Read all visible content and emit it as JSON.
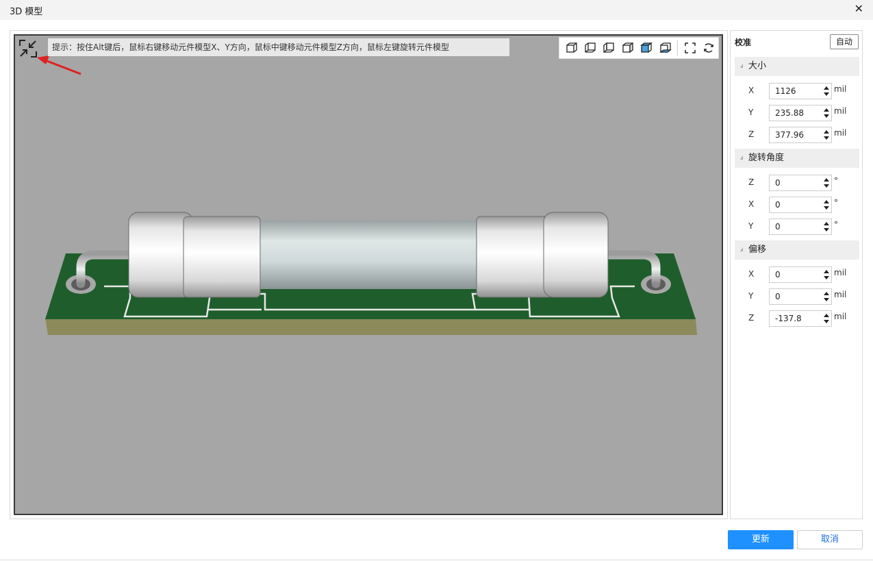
{
  "window": {
    "title": "3D 模型",
    "close_glyph": "✕"
  },
  "viewport": {
    "hint": "提示：按住Alt键后，鼠标右键移动元件模型X、Y方向，鼠标中键移动元件模型Z方向，鼠标左键旋转元件模型",
    "collapse_icon": "collapse-icon",
    "toolbar_icons": [
      "view-front-icon",
      "view-back-icon",
      "view-left-icon",
      "view-right-icon",
      "view-top-icon",
      "view-bottom-icon",
      "fit-view-icon",
      "reset-rotate-icon"
    ]
  },
  "panel": {
    "title": "校准",
    "auto_label": "自动",
    "size": {
      "header": "大小",
      "x": {
        "label": "X",
        "value": "1126",
        "unit": "mil"
      },
      "y": {
        "label": "Y",
        "value": "235.88",
        "unit": "mil"
      },
      "z": {
        "label": "Z",
        "value": "377.96",
        "unit": "mil"
      }
    },
    "rotation": {
      "header": "旋转角度",
      "z": {
        "label": "Z",
        "value": "0",
        "unit": "°"
      },
      "x": {
        "label": "X",
        "value": "0",
        "unit": "°"
      },
      "y": {
        "label": "Y",
        "value": "0",
        "unit": "°"
      }
    },
    "offset": {
      "header": "偏移",
      "x": {
        "label": "X",
        "value": "0",
        "unit": "mil"
      },
      "y": {
        "label": "Y",
        "value": "0",
        "unit": "mil"
      },
      "z": {
        "label": "Z",
        "value": "-137.8",
        "unit": "mil"
      }
    }
  },
  "footer": {
    "update_label": "更新",
    "cancel_label": "取消"
  },
  "colors": {
    "accent": "#1e90ff",
    "viewport_bg": "#a6a6a6",
    "pcb_green": "#1f5e2c",
    "pcb_edge": "#8c8a5a"
  }
}
